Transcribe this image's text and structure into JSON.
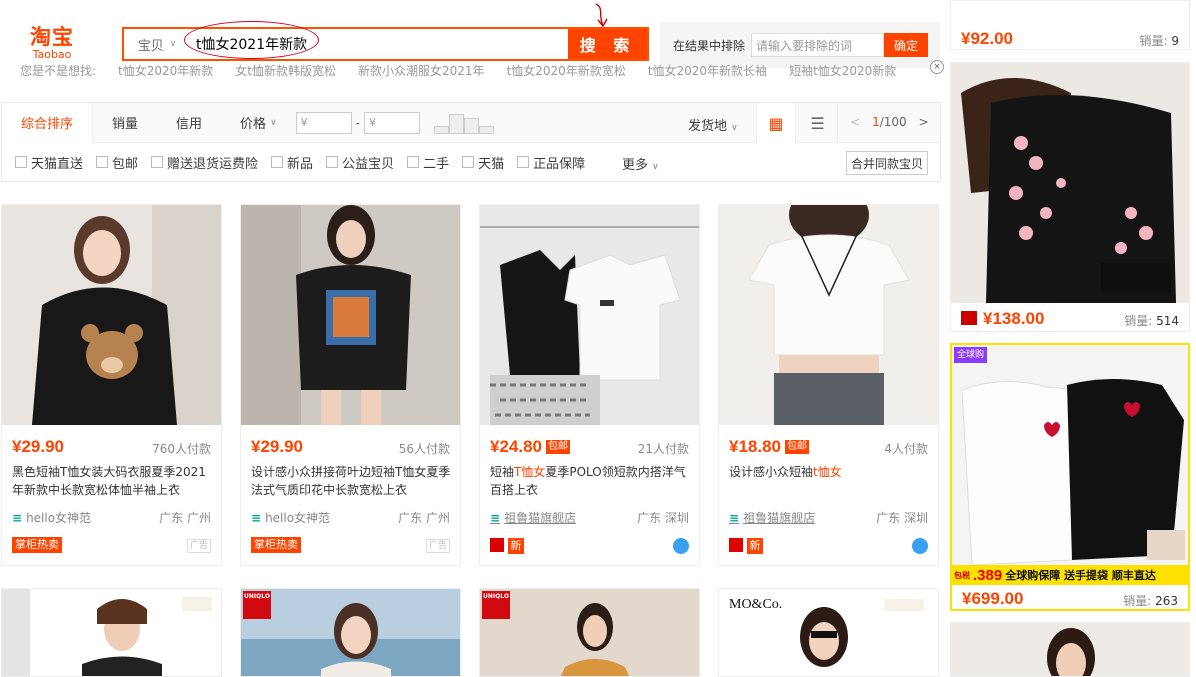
{
  "logo": {
    "cn": "淘宝",
    "en": "Taobao"
  },
  "search": {
    "category": "宝贝",
    "query": "t恤女2021年新款",
    "button": "搜 索"
  },
  "exclude": {
    "label": "在结果中排除",
    "placeholder": "请输入要排除的词",
    "button": "确定"
  },
  "hot_words": [
    "您是不是想找:",
    "t恤女2020年新款",
    "女t恤新款韩版宽松",
    "新款小众潮服女2021年",
    "t恤女2020年新款宽松",
    "t恤女2020年新款长袖",
    "短袖t恤女2020新款"
  ],
  "sort": {
    "tabs": [
      "综合排序",
      "销量",
      "信用",
      "价格"
    ],
    "price_from": "¥",
    "price_to": "¥",
    "ship_from": "发货地",
    "page_current": "1",
    "page_total": "/100"
  },
  "filters": [
    "天猫直送",
    "包邮",
    "赠送退货运费险",
    "新品",
    "公益宝贝",
    "二手",
    "天猫",
    "正品保障"
  ],
  "filter_more": "更多",
  "merge_button": "合并同款宝贝",
  "products": [
    {
      "price": "¥29.90",
      "sold": "760人付款",
      "baoyou": false,
      "title": "黑色短袖T恤女装大码衣服夏季2021年新款中长款宽松体恤半袖上衣",
      "shop": "hello女神范",
      "loc": "广东 广州",
      "badge": "掌柜热卖",
      "ad": "广告"
    },
    {
      "price": "¥29.90",
      "sold": "56人付款",
      "baoyou": false,
      "title": "设计感小众拼接荷叶边短袖T恤女夏季法式气质印花中长款宽松上衣",
      "shop": "hello女神范",
      "loc": "广东 广州",
      "badge": "掌柜热卖",
      "ad": "广告"
    },
    {
      "price": "¥24.80",
      "sold": "21人付款",
      "baoyou": true,
      "title_a": "短袖",
      "title_hl": "T恤女",
      "title_b": "夏季POLO领短款内搭洋气百搭上衣",
      "shop": "祖鲁猫旗舰店",
      "loc": "广东 深圳",
      "xin": "新"
    },
    {
      "price": "¥18.80",
      "sold": "4人付款",
      "baoyou": true,
      "title_a": "设计感小众短袖",
      "title_hl": "t恤女",
      "title_b": "",
      "shop": "祖鲁猫旗舰店",
      "loc": "广东 深圳",
      "xin": "新"
    }
  ],
  "baoyou_label": "包邮",
  "sidebar": [
    {
      "price": "¥92.00",
      "sold_label": "销量:",
      "sold": "9"
    },
    {
      "price": "¥138.00",
      "sold_label": "销量:",
      "sold": "514"
    },
    {
      "price": "¥699.00",
      "sold_label": "销量:",
      "sold": "263",
      "banner_price": "389",
      "banner_text": "全球购保障 送手提袋 顺丰直达",
      "banner_baoyou": "包税",
      "tag": "全球购"
    }
  ],
  "bottom_brands": [
    "",
    "UNIQLO",
    "UNIQLO",
    "MO&Co."
  ]
}
